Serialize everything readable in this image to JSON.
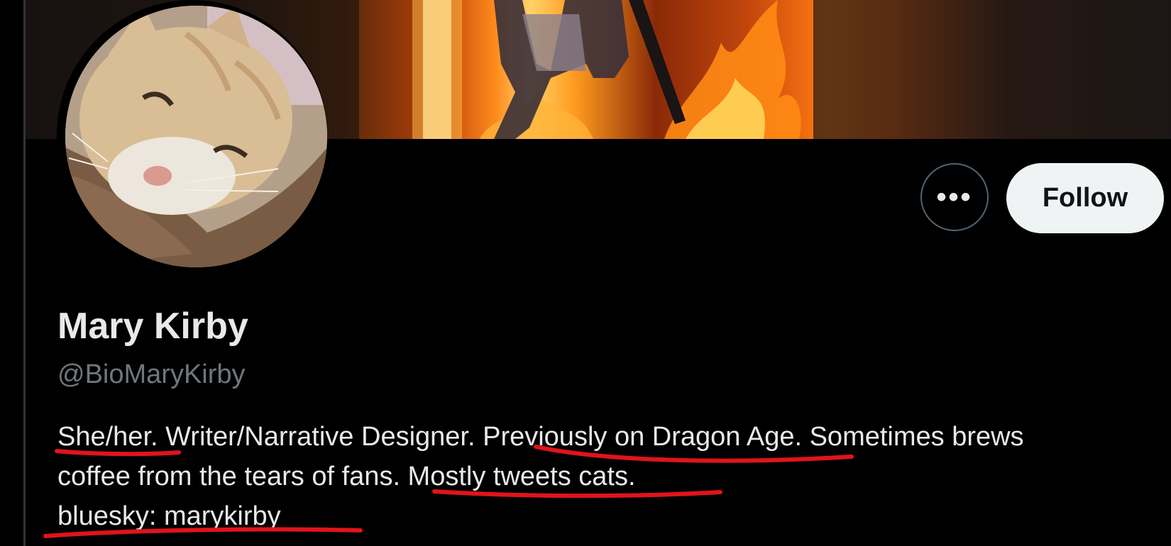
{
  "profile": {
    "display_name": "Mary Kirby",
    "handle": "@BioMaryKirby",
    "bio_lines": [
      "She/her. Writer/Narrative Designer. Previously on Dragon Age. Sometimes brews",
      "coffee from the tears of fans. Mostly tweets cats.",
      "bluesky: marykirby"
    ]
  },
  "actions": {
    "more_label": "•••",
    "follow_label": "Follow"
  },
  "icons": {
    "more": "more-horizontal-icon"
  },
  "colors": {
    "background": "#000000",
    "text_primary": "#e7e9ea",
    "text_secondary": "#71767b",
    "follow_button_bg": "#eff3f4",
    "annotation_red": "#e0141c"
  }
}
